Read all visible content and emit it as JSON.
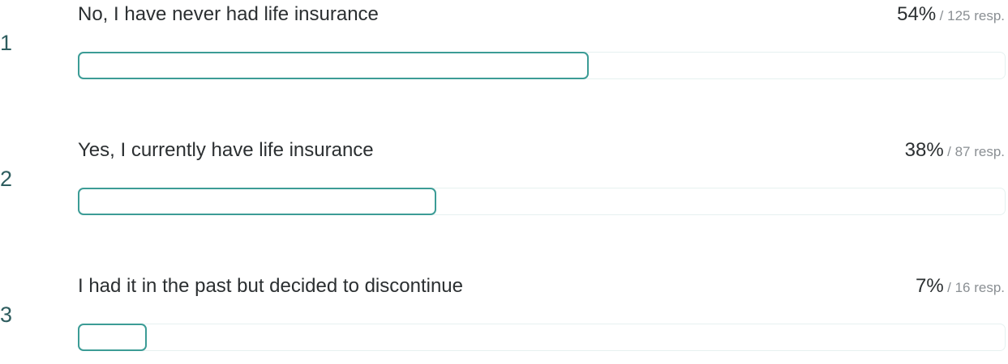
{
  "results": [
    {
      "rank": "1",
      "label": "No, I have never had life insurance",
      "percent_label": "54%",
      "responses_label": "/ 125 resp.",
      "fraction": 0.55
    },
    {
      "rank": "2",
      "label": "Yes, I currently have life insurance",
      "percent_label": "38%",
      "responses_label": "/ 87 resp.",
      "fraction": 0.385
    },
    {
      "rank": "3",
      "label": "I had it in the past but decided to discontinue",
      "percent_label": "7%",
      "responses_label": "/ 16 resp.",
      "fraction": 0.073
    }
  ],
  "colors": {
    "accent": "#3c9c96",
    "track_border": "#e6f1f0",
    "rank_text": "#2e5d5f",
    "muted_text": "#8a8f93"
  }
}
